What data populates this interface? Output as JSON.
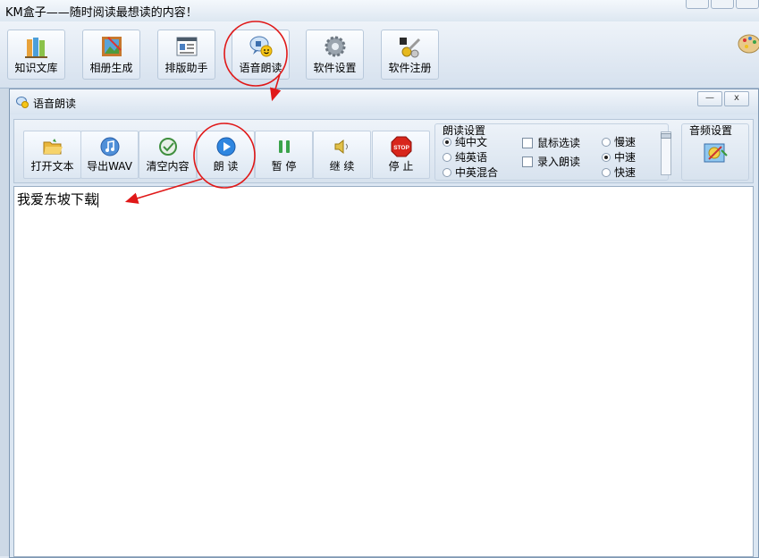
{
  "main_window": {
    "title": "KM盒子——随时阅读最想读的内容！",
    "toolbar": [
      {
        "label": "知识文库",
        "icon": "books-icon"
      },
      {
        "label": "相册生成",
        "icon": "picture-frame-icon"
      },
      {
        "label": "排版助手",
        "icon": "layout-icon"
      },
      {
        "label": "语音朗读",
        "icon": "speech-icon"
      },
      {
        "label": "软件设置",
        "icon": "gear-icon"
      },
      {
        "label": "软件注册",
        "icon": "keys-icon"
      }
    ]
  },
  "dialog": {
    "title": "语音朗读",
    "minimize_label": "—",
    "close_label": "x",
    "toolbar": {
      "open_text": "打开文本",
      "export_wav": "导出WAV",
      "clear_content": "清空内容",
      "read": "朗 读",
      "pause": "暂 停",
      "resume": "继 续",
      "stop": "停 止",
      "stop_sign_text": "STOP"
    },
    "read_settings": {
      "title": "朗读设置",
      "options": [
        "纯中文",
        "纯英语",
        "中英混合"
      ],
      "selected": "纯中文"
    },
    "checkboxes": [
      {
        "label": "鼠标选读",
        "checked": false
      },
      {
        "label": "录入朗读",
        "checked": false
      }
    ],
    "speed": {
      "options": [
        "慢速",
        "中速",
        "快速"
      ],
      "selected": "中速"
    },
    "audio_settings": {
      "title": "音频设置"
    },
    "editor_text": "我爱东坡下载"
  },
  "colors": {
    "annotation_red": "#e01818",
    "window_bg": "#dfe8f2"
  }
}
